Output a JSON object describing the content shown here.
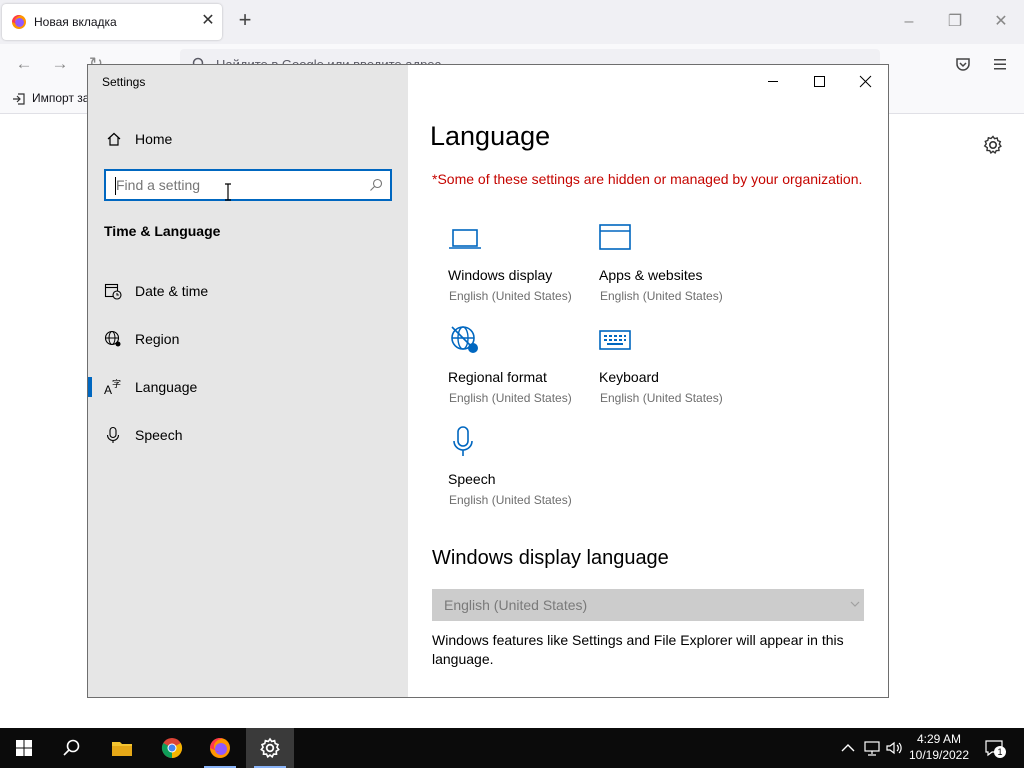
{
  "browser": {
    "tab_title": "Новая вкладка",
    "url_placeholder": "Найдите в Google или введите адрес",
    "bookmark_item": "Импорт за"
  },
  "settings": {
    "window_title": "Settings",
    "home_label": "Home",
    "search_placeholder": "Find a setting",
    "section_heading": "Time & Language",
    "nav_items": [
      {
        "label": "Date & time",
        "icon": "calendar-clock-icon"
      },
      {
        "label": "Region",
        "icon": "globe-icon"
      },
      {
        "label": "Language",
        "icon": "language-icon",
        "selected": true
      },
      {
        "label": "Speech",
        "icon": "microphone-icon"
      }
    ],
    "page_title": "Language",
    "notice": "*Some of these settings are hidden or managed by your organization.",
    "tiles": [
      {
        "label": "Windows display",
        "sub": "English (United States)",
        "icon": "laptop-icon"
      },
      {
        "label": "Apps & websites",
        "sub": "English (United States)",
        "icon": "window-icon"
      },
      {
        "label": "Regional format",
        "sub": "English (United States)",
        "icon": "globe-format-icon"
      },
      {
        "label": "Keyboard",
        "sub": "English (United States)",
        "icon": "keyboard-icon"
      },
      {
        "label": "Speech",
        "sub": "English (United States)",
        "icon": "microphone-icon"
      }
    ],
    "display_language_heading": "Windows display language",
    "display_language_value": "English (United States)",
    "display_language_desc": "Windows features like Settings and File Explorer will appear in this language."
  },
  "taskbar": {
    "time": "4:29 AM",
    "date": "10/19/2022",
    "notification_count": "1"
  },
  "colors": {
    "accent": "#0067c0",
    "notice_red": "#c50500",
    "sidebar_bg": "#e6e6e6",
    "taskbar_bg": "#0b0b0b"
  }
}
